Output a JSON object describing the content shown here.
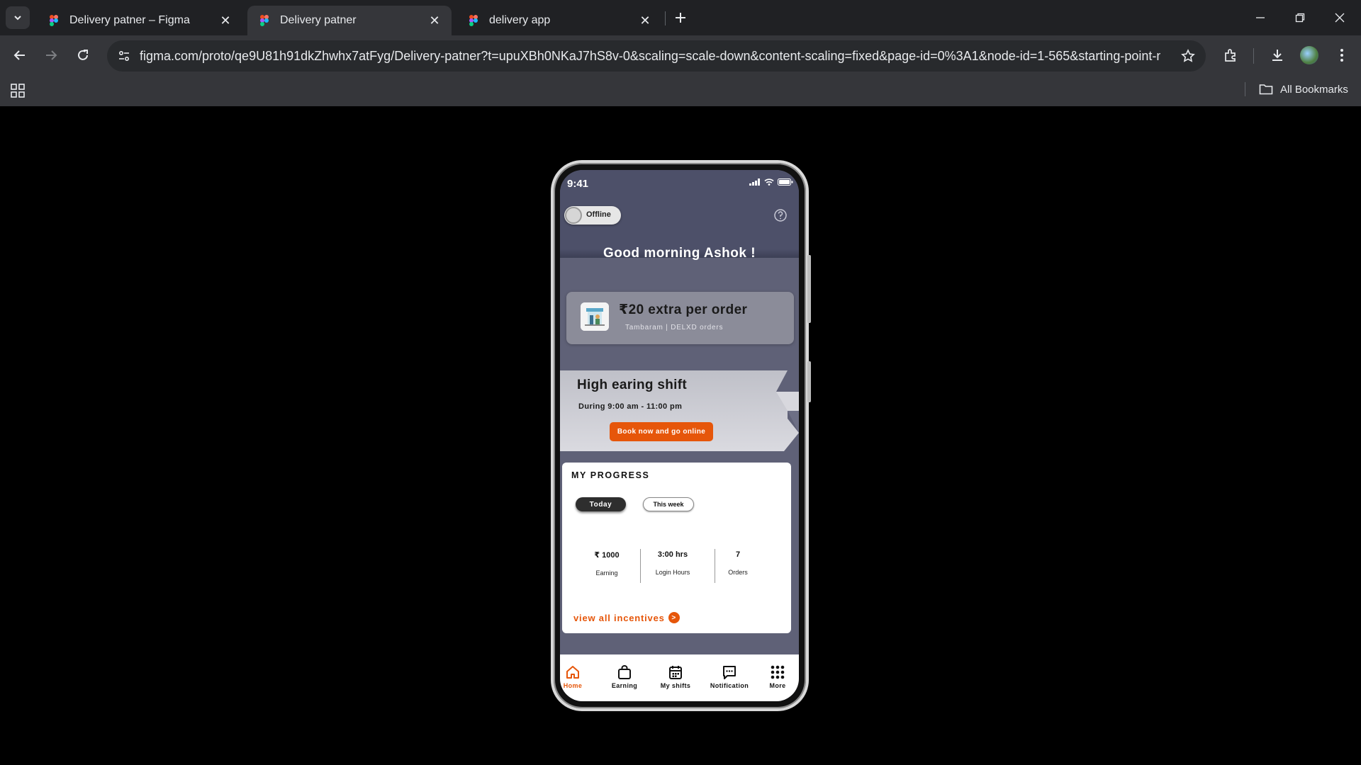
{
  "browser": {
    "tabs": [
      {
        "title": "Delivery patner – Figma",
        "active": false
      },
      {
        "title": "Delivery patner",
        "active": true
      },
      {
        "title": "delivery app",
        "active": false
      }
    ],
    "url": "figma.com/proto/qe9U81h91dkZhwhx7atFyg/Delivery-patner?t=upuXBh0NKaJ7hS8v-0&scaling=scale-down&content-scaling=fixed&page-id=0%3A1&node-id=1-565&starting-point-n...",
    "bookmarks_label": "All Bookmarks"
  },
  "app": {
    "status_time": "9:41",
    "toggle_label": "Offline",
    "greeting": "Good morning Ashok !",
    "promo": {
      "amount": "₹20 extra per order",
      "subtitle": "Tambaram | DELXD orders"
    },
    "shift": {
      "title": "High earing shift",
      "time": "During 9:00 am  -  11:00 pm",
      "button": "Book now and go online"
    },
    "progress": {
      "title": "MY PROGRESS",
      "tabs": [
        "Today",
        "This week"
      ],
      "stats": [
        {
          "value": "₹ 1000",
          "caption": "Earning"
        },
        {
          "value": "3:00 hrs",
          "caption": "Login Hours"
        },
        {
          "value": "7",
          "caption": "Orders"
        }
      ],
      "link": "view all incentives",
      "link_arrow": ">"
    },
    "nav": [
      {
        "label": "Home",
        "icon": "home-icon",
        "active": true
      },
      {
        "label": "Earning",
        "icon": "bag-icon",
        "active": false
      },
      {
        "label": "My shifts",
        "icon": "calendar-icon",
        "active": false
      },
      {
        "label": "Notification",
        "icon": "chat-icon",
        "active": false
      },
      {
        "label": "More",
        "icon": "grid-dots-icon",
        "active": false
      }
    ],
    "colors": {
      "accent": "#e6560a",
      "header": "#4d5069",
      "background": "#5f6177"
    }
  }
}
